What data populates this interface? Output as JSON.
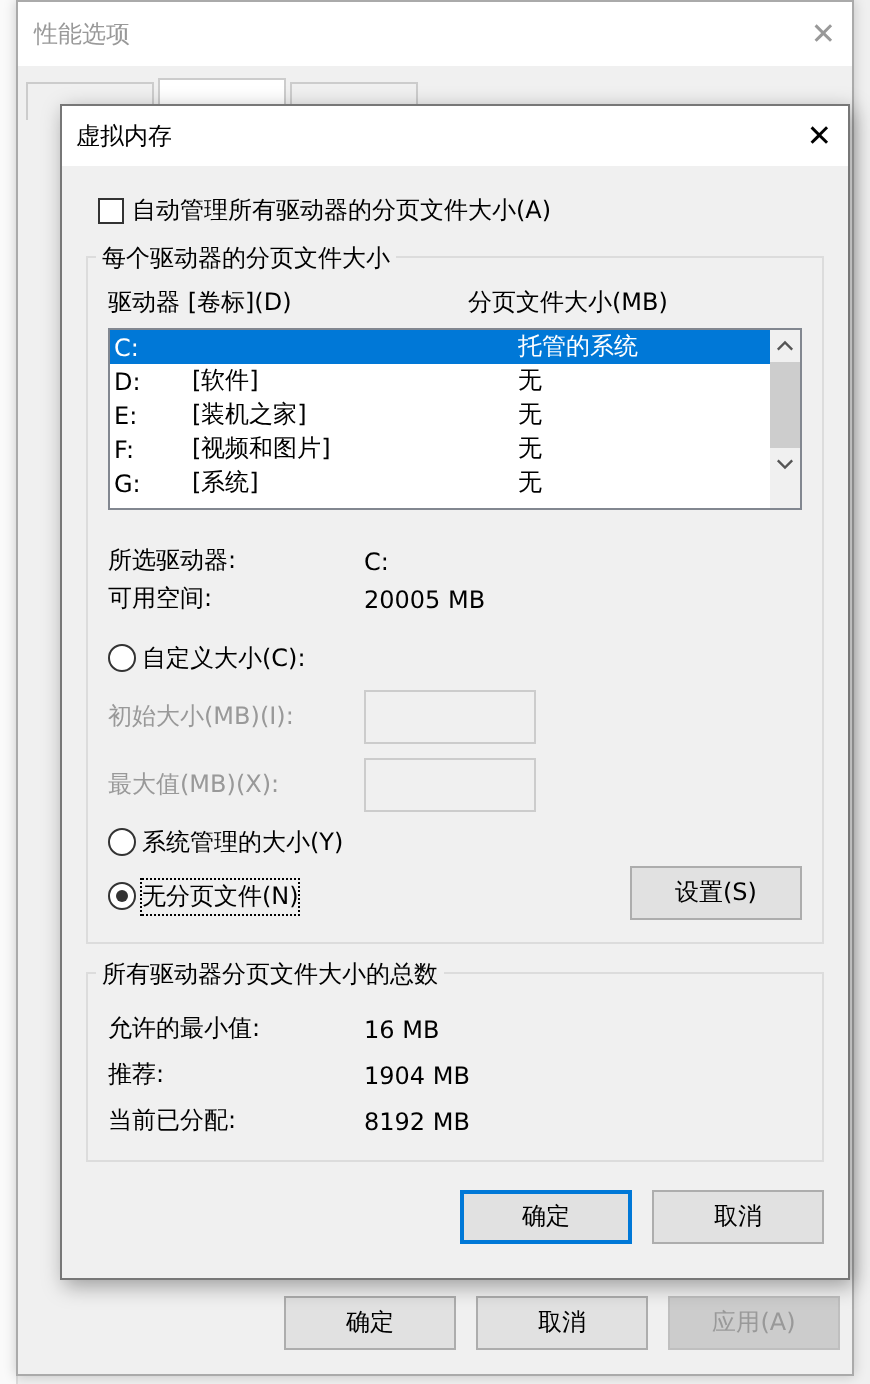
{
  "back_window": {
    "title": "性能选项",
    "close": "✕",
    "tabs": [
      {
        "selected": false
      },
      {
        "selected": true
      },
      {
        "selected": false
      }
    ],
    "buttons": [
      {
        "label": "确定",
        "disabled": false
      },
      {
        "label": "取消",
        "disabled": false
      },
      {
        "label": "应用(A)",
        "disabled": true
      }
    ]
  },
  "dialog": {
    "title": "虚拟内存",
    "close": "✕",
    "auto_manage": {
      "label": "自动管理所有驱动器的分页文件大小(A)",
      "checked": false
    },
    "per_drive": {
      "title": "每个驱动器的分页文件大小",
      "columns": [
        "驱动器 [卷标](D)",
        "分页文件大小(MB)"
      ],
      "rows": [
        {
          "drive": "C:",
          "label": "",
          "size": "托管的系统",
          "selected": true
        },
        {
          "drive": "D:",
          "label": "[软件]",
          "size": "无",
          "selected": false
        },
        {
          "drive": "E:",
          "label": "[装机之家]",
          "size": "无",
          "selected": false
        },
        {
          "drive": "F:",
          "label": "[视频和图片]",
          "size": "无",
          "selected": false
        },
        {
          "drive": "G:",
          "label": "[系统]",
          "size": "无",
          "selected": false
        }
      ],
      "info": [
        {
          "label": "所选驱动器:",
          "value": "C:"
        },
        {
          "label": "可用空间:",
          "value": "20005 MB"
        }
      ],
      "options": [
        {
          "label": "自定义大小(C):",
          "selected": false,
          "fields": [
            {
              "label": "初始大小(MB)(I):",
              "disabled": true
            },
            {
              "label": "最大值(MB)(X):",
              "disabled": true
            }
          ]
        },
        {
          "label": "系统管理的大小(Y)",
          "selected": false
        },
        {
          "label": "无分页文件(N)",
          "selected": true
        }
      ],
      "set_button": "设置(S)"
    },
    "totals": {
      "title": "所有驱动器分页文件大小的总数",
      "rows": [
        {
          "label": "允许的最小值:",
          "value": "16 MB"
        },
        {
          "label": "推荐:",
          "value": "1904 MB"
        },
        {
          "label": "当前已分配:",
          "value": "8192 MB"
        }
      ]
    },
    "buttons": [
      {
        "label": "确定",
        "default": true
      },
      {
        "label": "取消",
        "default": false
      }
    ]
  }
}
